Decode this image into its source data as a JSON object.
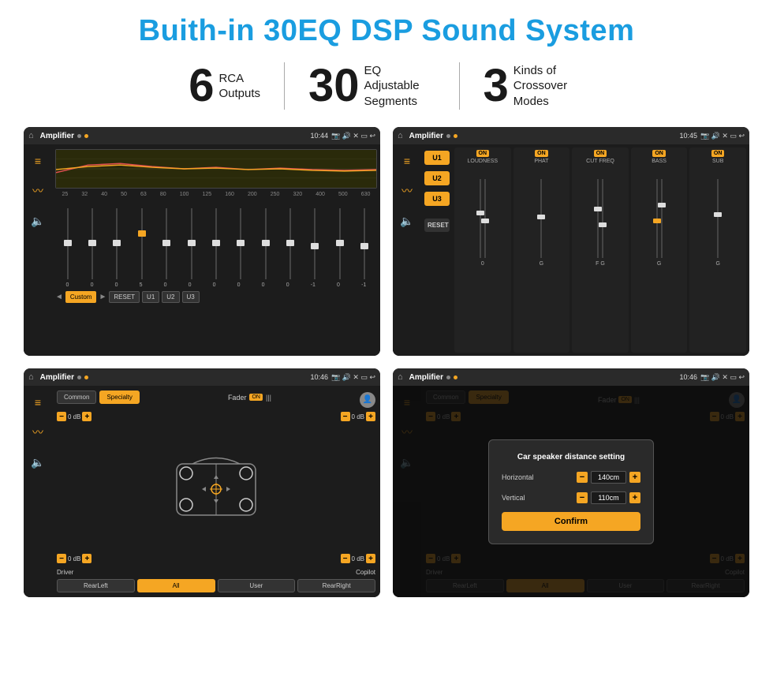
{
  "title": "Buith-in 30EQ DSP Sound System",
  "stats": [
    {
      "number": "6",
      "label": "RCA\nOutputs"
    },
    {
      "number": "30",
      "label": "EQ Adjustable\nSegments"
    },
    {
      "number": "3",
      "label": "Kinds of\nCrossover Modes"
    }
  ],
  "screen1": {
    "statusbar": {
      "title": "Amplifier",
      "time": "10:44"
    },
    "eq_labels": [
      "25",
      "32",
      "40",
      "50",
      "63",
      "80",
      "100",
      "125",
      "160",
      "200",
      "250",
      "320",
      "400",
      "500",
      "630"
    ],
    "eq_values": [
      "0",
      "0",
      "0",
      "5",
      "0",
      "0",
      "0",
      "0",
      "0",
      "0",
      "-1",
      "0",
      "-1"
    ],
    "buttons": [
      "Custom",
      "RESET",
      "U1",
      "U2",
      "U3"
    ]
  },
  "screen2": {
    "statusbar": {
      "title": "Amplifier",
      "time": "10:45"
    },
    "u_buttons": [
      "U1",
      "U2",
      "U3"
    ],
    "channels": [
      {
        "toggle": "ON",
        "label": "LOUDNESS"
      },
      {
        "toggle": "ON",
        "label": "PHAT"
      },
      {
        "toggle": "ON",
        "label": "CUT FREQ"
      },
      {
        "toggle": "ON",
        "label": "BASS"
      },
      {
        "toggle": "ON",
        "label": "SUB"
      }
    ]
  },
  "screen3": {
    "statusbar": {
      "title": "Amplifier",
      "time": "10:46"
    },
    "tabs": [
      "Common",
      "Specialty"
    ],
    "fader_label": "Fader",
    "fader_on": "ON",
    "vol_groups": [
      {
        "label": "0 dB"
      },
      {
        "label": "0 dB"
      }
    ],
    "vol_groups2": [
      {
        "label": "0 dB"
      },
      {
        "label": "0 dB"
      }
    ],
    "bottom_labels": [
      "Driver",
      "",
      "Copilot"
    ],
    "bottom_btns": [
      "RearLeft",
      "All",
      "User",
      "RearRight"
    ]
  },
  "screen4": {
    "statusbar": {
      "title": "Amplifier",
      "time": "10:46"
    },
    "tabs": [
      "Common",
      "Specialty"
    ],
    "dialog": {
      "title": "Car speaker distance setting",
      "horizontal_label": "Horizontal",
      "horizontal_value": "140cm",
      "vertical_label": "Vertical",
      "vertical_value": "110cm",
      "confirm_label": "Confirm"
    },
    "bottom_labels": [
      "Driver",
      "",
      "Copilot"
    ],
    "bottom_btns": [
      "RearLeft",
      "All",
      "User",
      "RearRight"
    ]
  }
}
